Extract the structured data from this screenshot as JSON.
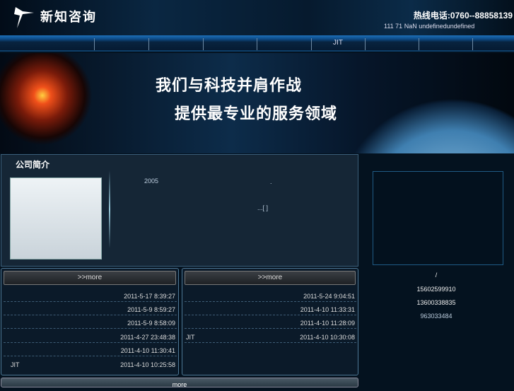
{
  "header": {
    "logo": "新知咨询",
    "hotline": "热线电话:0760--88858139",
    "ticker": "111 71    NaN  undefinedundefined"
  },
  "nav": {
    "active_item": "JIT"
  },
  "banner": {
    "line1": "我们与科技并肩作战",
    "line2": "提供最专业的服务领域"
  },
  "about": {
    "title": "公司简介",
    "year": "2005",
    "dot": ".",
    "more": "...[ ]"
  },
  "contact": {
    "slash": "/",
    "phone1": "15602599910",
    "phone2": "13600338835",
    "qq": "963033484"
  },
  "list_left": {
    "more": ">>more",
    "rows": [
      {
        "name": "",
        "time": "2011-5-17 8:39:27"
      },
      {
        "name": "",
        "time": "2011-5-9 8:59:27"
      },
      {
        "name": "",
        "time": "2011-5-9 8:58:09"
      },
      {
        "name": "",
        "time": "2011-4-27 23:48:38"
      },
      {
        "name": "",
        "time": "2011-4-10 11:30:41"
      },
      {
        "name": "JIT",
        "time": "2011-4-10 10:25:58"
      }
    ]
  },
  "list_right": {
    "more": ">>more",
    "rows": [
      {
        "name": "",
        "time": "2011-5-24 9:04:51"
      },
      {
        "name": "",
        "time": "2011-4-10 11:33:31"
      },
      {
        "name": "",
        "time": "2011-4-10 11:28:09"
      },
      {
        "name": "JIT",
        "time": "2011-4-10 10:30:08"
      }
    ]
  },
  "bottom": {
    "more": "more"
  }
}
